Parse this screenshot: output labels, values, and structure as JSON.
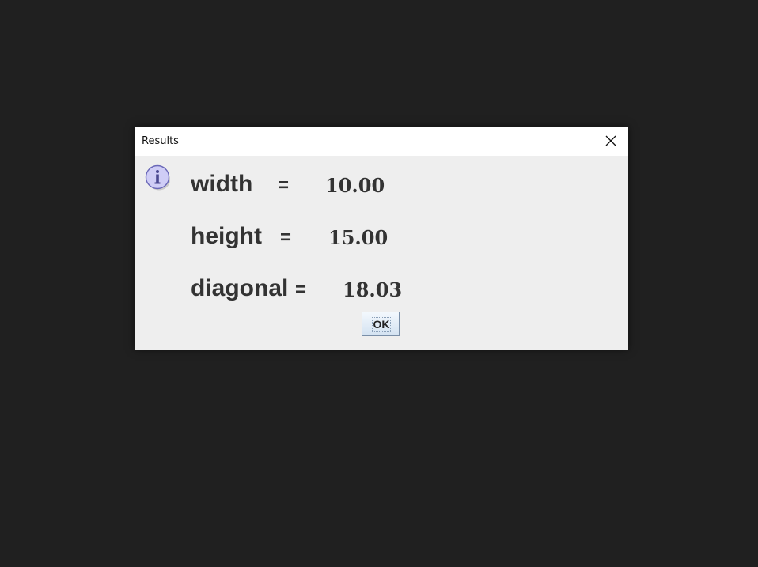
{
  "dialog": {
    "title": "Results",
    "icon": "info-icon",
    "rows": [
      {
        "label": "width",
        "eq": "=",
        "value": "10.00"
      },
      {
        "label": "height",
        "eq": "=",
        "value": "15.00"
      },
      {
        "label": "diagonal",
        "eq": "=",
        "value": "18.03"
      }
    ],
    "ok_label": "OK"
  },
  "colors": {
    "desktop": "#202020",
    "dialog_bg": "#eeeeee",
    "text": "#333333",
    "icon_fill": "#c9c6f2"
  }
}
